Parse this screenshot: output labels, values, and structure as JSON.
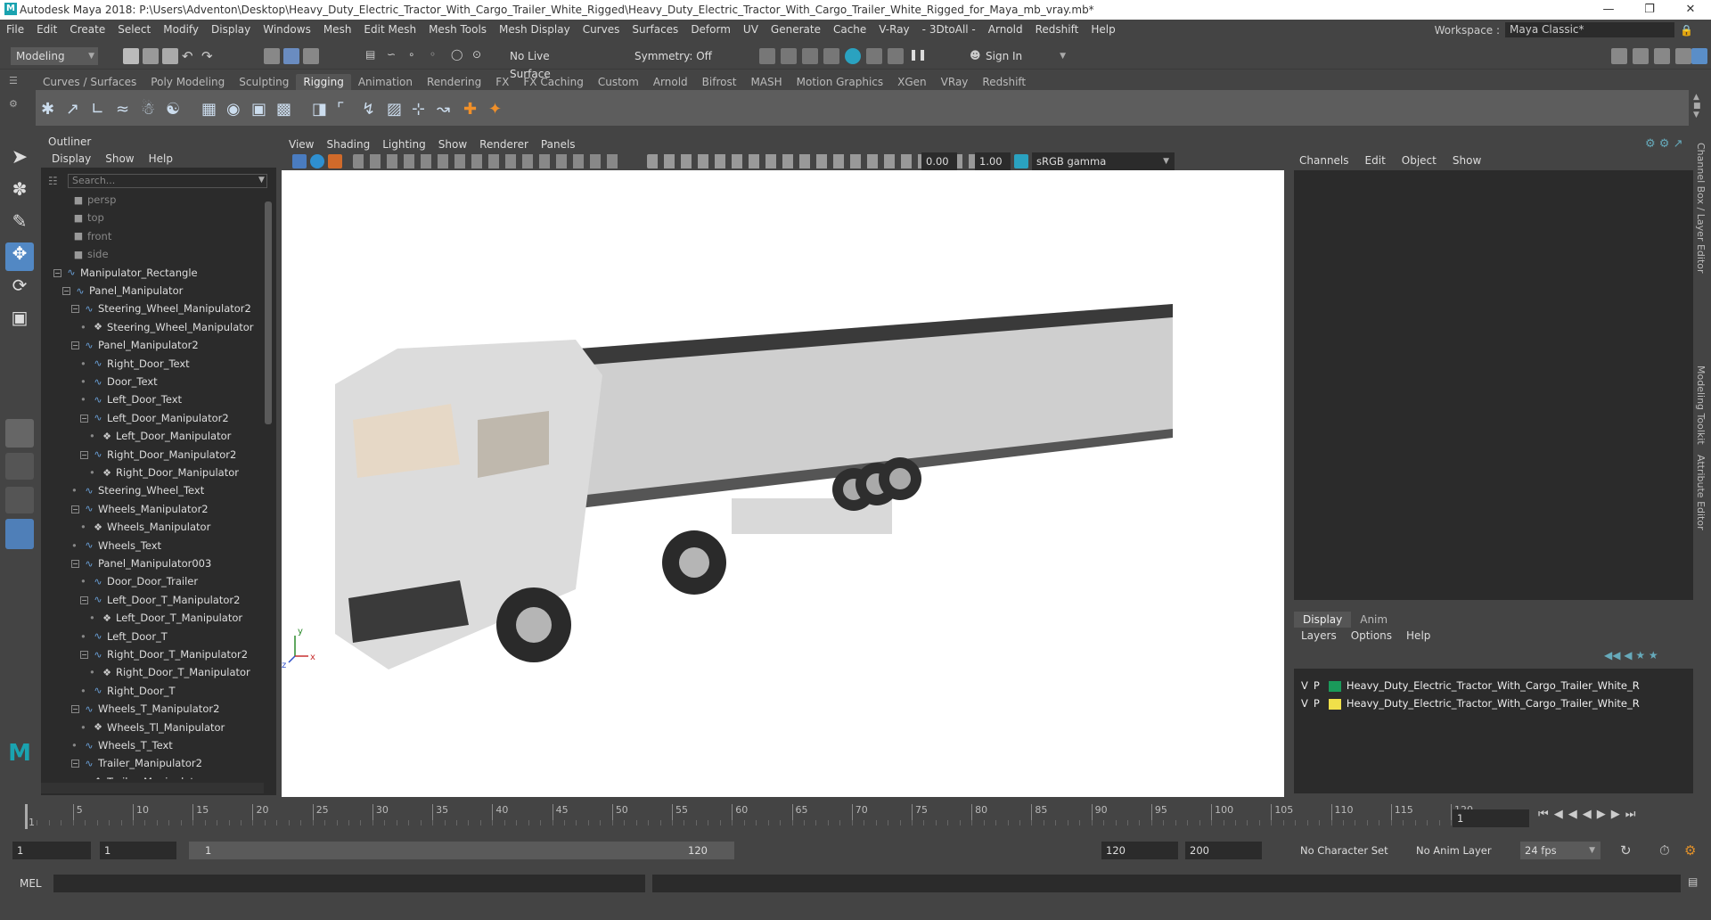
{
  "window": {
    "title": "Autodesk Maya 2018: P:\\Users\\Adventon\\Desktop\\Heavy_Duty_Electric_Tractor_With_Cargo_Trailer_White_Rigged\\Heavy_Duty_Electric_Tractor_With_Cargo_Trailer_White_Rigged_for_Maya_mb_vray.mb*",
    "logo": "M"
  },
  "menubar": [
    "File",
    "Edit",
    "Create",
    "Select",
    "Modify",
    "Display",
    "Windows",
    "Mesh",
    "Edit Mesh",
    "Mesh Tools",
    "Mesh Display",
    "Curves",
    "Surfaces",
    "Deform",
    "UV",
    "Generate",
    "Cache",
    "V-Ray",
    "- 3DtoAll -",
    "Arnold",
    "Redshift",
    "Help"
  ],
  "workspace": {
    "label": "Workspace :",
    "value": "Maya Classic*"
  },
  "statusline": {
    "mode": "Modeling",
    "live_surface": "No Live Surface",
    "symmetry": "Symmetry: Off",
    "sign_in": "Sign In"
  },
  "shelf_tabs": [
    "Curves / Surfaces",
    "Poly Modeling",
    "Sculpting",
    "Rigging",
    "Animation",
    "Rendering",
    "FX",
    "FX Caching",
    "Custom",
    "Arnold",
    "Bifrost",
    "MASH",
    "Motion Graphics",
    "XGen",
    "VRay",
    "Redshift"
  ],
  "shelf_active": "Rigging",
  "outliner": {
    "title": "Outliner",
    "menu": [
      "Display",
      "Show",
      "Help"
    ],
    "search_placeholder": "Search...",
    "items": [
      {
        "label": "persp",
        "depth": 0,
        "kind": "camera",
        "pm": ""
      },
      {
        "label": "top",
        "depth": 0,
        "kind": "camera",
        "pm": ""
      },
      {
        "label": "front",
        "depth": 0,
        "kind": "camera",
        "pm": ""
      },
      {
        "label": "side",
        "depth": 0,
        "kind": "camera",
        "pm": ""
      },
      {
        "label": "Manipulator_Rectangle",
        "depth": 0,
        "kind": "curve",
        "pm": "−"
      },
      {
        "label": "Panel_Manipulator",
        "depth": 1,
        "kind": "curve",
        "pm": "−"
      },
      {
        "label": "Steering_Wheel_Manipulator2",
        "depth": 2,
        "kind": "curve",
        "pm": "−"
      },
      {
        "label": "Steering_Wheel_Manipulator",
        "depth": 3,
        "kind": "mesh",
        "pm": ""
      },
      {
        "label": "Panel_Manipulator2",
        "depth": 2,
        "kind": "curve",
        "pm": "−"
      },
      {
        "label": "Right_Door_Text",
        "depth": 3,
        "kind": "curve",
        "pm": ""
      },
      {
        "label": "Door_Text",
        "depth": 3,
        "kind": "curve",
        "pm": ""
      },
      {
        "label": "Left_Door_Text",
        "depth": 3,
        "kind": "curve",
        "pm": ""
      },
      {
        "label": "Left_Door_Manipulator2",
        "depth": 3,
        "kind": "curve",
        "pm": "−"
      },
      {
        "label": "Left_Door_Manipulator",
        "depth": 4,
        "kind": "mesh",
        "pm": ""
      },
      {
        "label": "Right_Door_Manipulator2",
        "depth": 3,
        "kind": "curve",
        "pm": "−"
      },
      {
        "label": "Right_Door_Manipulator",
        "depth": 4,
        "kind": "mesh",
        "pm": ""
      },
      {
        "label": "Steering_Wheel_Text",
        "depth": 2,
        "kind": "curve",
        "pm": ""
      },
      {
        "label": "Wheels_Manipulator2",
        "depth": 2,
        "kind": "curve",
        "pm": "−"
      },
      {
        "label": "Wheels_Manipulator",
        "depth": 3,
        "kind": "mesh",
        "pm": ""
      },
      {
        "label": "Wheels_Text",
        "depth": 2,
        "kind": "curve",
        "pm": ""
      },
      {
        "label": "Panel_Manipulator003",
        "depth": 2,
        "kind": "curve",
        "pm": "−"
      },
      {
        "label": "Door_Door_Trailer",
        "depth": 3,
        "kind": "curve",
        "pm": ""
      },
      {
        "label": "Left_Door_T_Manipulator2",
        "depth": 3,
        "kind": "curve",
        "pm": "−"
      },
      {
        "label": "Left_Door_T_Manipulator",
        "depth": 4,
        "kind": "mesh",
        "pm": ""
      },
      {
        "label": "Left_Door_T",
        "depth": 3,
        "kind": "curve",
        "pm": ""
      },
      {
        "label": "Right_Door_T_Manipulator2",
        "depth": 3,
        "kind": "curve",
        "pm": "−"
      },
      {
        "label": "Right_Door_T_Manipulator",
        "depth": 4,
        "kind": "mesh",
        "pm": ""
      },
      {
        "label": "Right_Door_T",
        "depth": 3,
        "kind": "curve",
        "pm": ""
      },
      {
        "label": "Wheels_T_Manipulator2",
        "depth": 2,
        "kind": "curve",
        "pm": "−"
      },
      {
        "label": "Wheels_Tl_Manipulator",
        "depth": 3,
        "kind": "mesh",
        "pm": ""
      },
      {
        "label": "Wheels_T_Text",
        "depth": 2,
        "kind": "curve",
        "pm": ""
      },
      {
        "label": "Trailer_Manipulator2",
        "depth": 2,
        "kind": "curve",
        "pm": "−"
      },
      {
        "label": "Trailer_Manipulator",
        "depth": 3,
        "kind": "mesh",
        "pm": ""
      }
    ]
  },
  "viewport": {
    "menu": [
      "View",
      "Shading",
      "Lighting",
      "Show",
      "Renderer",
      "Panels"
    ],
    "exposure": "0.00",
    "gamma": "1.00",
    "color_space": "sRGB gamma",
    "axis_x": "x",
    "axis_y": "y",
    "axis_z": "z"
  },
  "channelbox": {
    "menu": [
      "Channels",
      "Edit",
      "Object",
      "Show"
    ],
    "layer_tabs": [
      "Display",
      "Anim"
    ],
    "layer_menu": [
      "Layers",
      "Options",
      "Help"
    ],
    "layers": [
      {
        "v": "V",
        "p": "P",
        "color": "#1a9a5a",
        "name": "Heavy_Duty_Electric_Tractor_With_Cargo_Trailer_White_R"
      },
      {
        "v": "V",
        "p": "P",
        "color": "#f0e04a",
        "name": "Heavy_Duty_Electric_Tractor_With_Cargo_Trailer_White_R"
      }
    ]
  },
  "side_tabs": [
    "Channel Box / Layer Editor",
    "Modeling Toolkit",
    "Attribute Editor"
  ],
  "timeline": {
    "ticks": [
      "1",
      "5",
      "10",
      "15",
      "20",
      "25",
      "30",
      "35",
      "40",
      "45",
      "50",
      "55",
      "60",
      "65",
      "70",
      "75",
      "80",
      "85",
      "90",
      "95",
      "100",
      "105",
      "110",
      "115",
      "120"
    ],
    "current_frame": "1"
  },
  "range": {
    "start": "1",
    "playback_start": "1",
    "slider_start": "1",
    "slider_end": "120",
    "playback_end": "120",
    "end": "200",
    "character_set": "No Character Set",
    "anim_layer": "No Anim Layer",
    "fps": "24 fps"
  },
  "cmdline": {
    "label": "MEL"
  }
}
